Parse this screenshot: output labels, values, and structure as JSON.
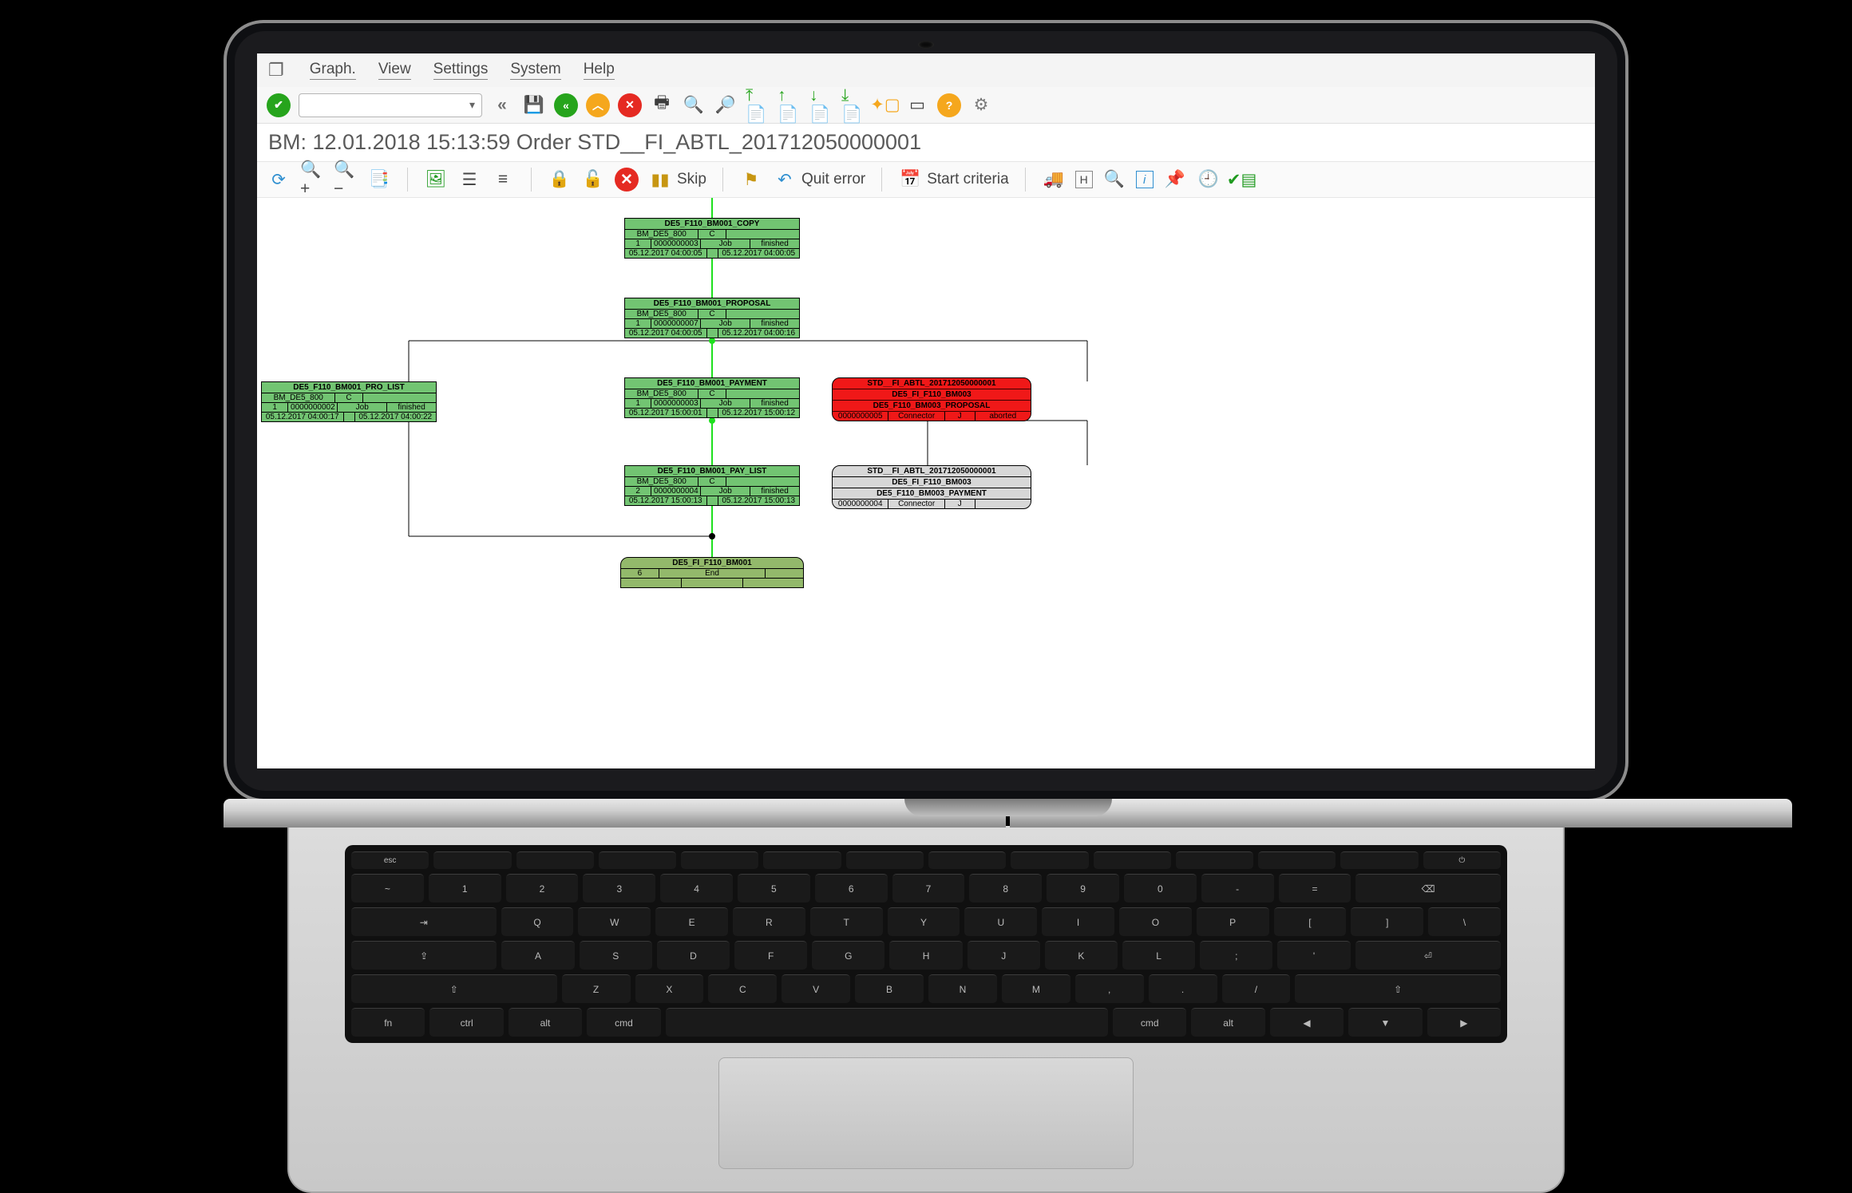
{
  "menu": {
    "graph": "Graph.",
    "view": "View",
    "settings": "Settings",
    "system": "System",
    "help": "Help"
  },
  "toolbar1": {
    "combo_value": ""
  },
  "title": "BM: 12.01.2018 15:13:59 Order STD__FI_ABTL_201712050000001",
  "toolbar2": {
    "skip": "Skip",
    "quit": "Quit error",
    "start": "Start criteria"
  },
  "nodes": {
    "copy": {
      "title": "DE5_F110_BM001_COPY",
      "sys": "BM_DE5_800",
      "flag": "C",
      "seq": "1",
      "id": "0000000003",
      "type": "Job",
      "state": "finished",
      "ts1": "05.12.2017 04:00:05",
      "ts2": "05.12.2017 04:00:05"
    },
    "proposal": {
      "title": "DE5_F110_BM001_PROPOSAL",
      "sys": "BM_DE5_800",
      "flag": "C",
      "seq": "1",
      "id": "0000000007",
      "type": "Job",
      "state": "finished",
      "ts1": "05.12.2017 04:00:05",
      "ts2": "05.12.2017 04:00:16"
    },
    "prolist": {
      "title": "DE5_F110_BM001_PRO_LIST",
      "sys": "BM_DE5_800",
      "flag": "C",
      "seq": "1",
      "id": "0000000002",
      "type": "Job",
      "state": "finished",
      "ts1": "05.12.2017 04:00:17",
      "ts2": "05.12.2017 04:00:22"
    },
    "payment": {
      "title": "DE5_F110_BM001_PAYMENT",
      "sys": "BM_DE5_800",
      "flag": "C",
      "seq": "1",
      "id": "0000000003",
      "type": "Job",
      "state": "finished",
      "ts1": "05.12.2017 15:00:01",
      "ts2": "05.12.2017 15:00:12"
    },
    "paylist": {
      "title": "DE5_F110_BM001_PAY_LIST",
      "sys": "BM_DE5_800",
      "flag": "C",
      "seq": "2",
      "id": "0000000004",
      "type": "Job",
      "state": "finished",
      "ts1": "05.12.2017 15:00:13",
      "ts2": "05.12.2017 15:00:13"
    },
    "red": {
      "l1": "STD__FI_ABTL_201712050000001",
      "l2": "DE5_FI_F110_BM003",
      "l3": "DE5_F110_BM003_PROPOSAL",
      "id": "0000000005",
      "type": "Connector",
      "flag": "J",
      "state": "aborted"
    },
    "grey": {
      "l1": "STD__FI_ABTL_201712050000001",
      "l2": "DE5_FI_F110_BM003",
      "l3": "DE5_F110_BM003_PAYMENT",
      "id": "0000000004",
      "type": "Connector",
      "flag": "J",
      "state": ""
    },
    "end": {
      "title": "DE5_FI_F110_BM001",
      "seq": "6",
      "state": "End"
    }
  }
}
